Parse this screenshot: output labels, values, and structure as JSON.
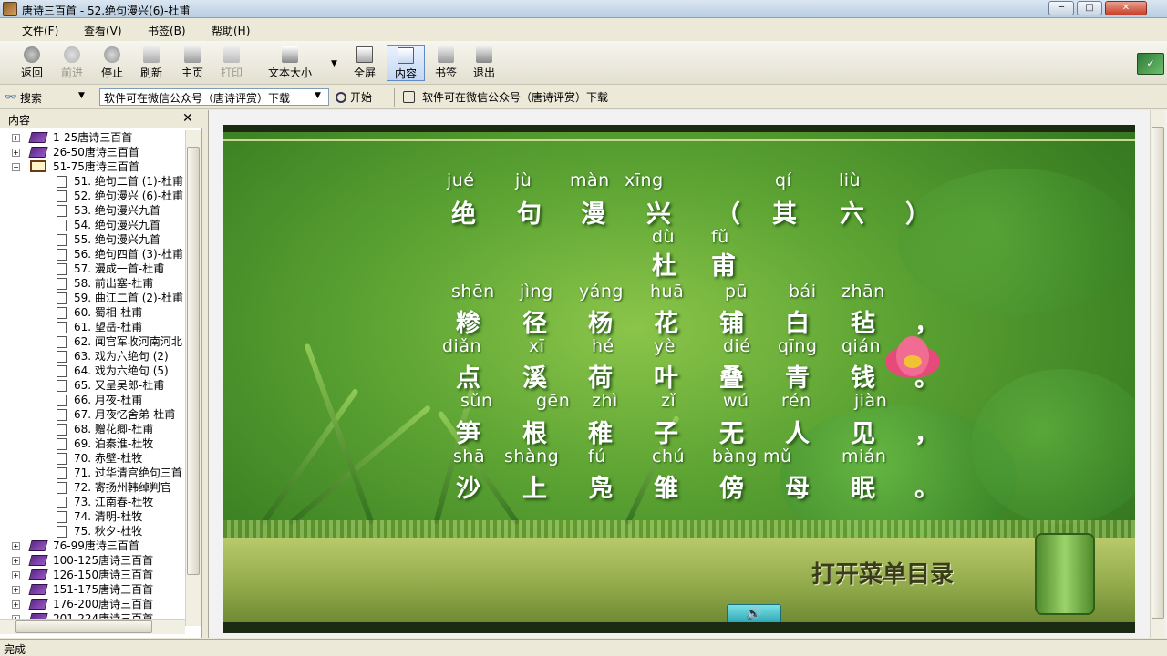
{
  "window": {
    "title": "唐诗三百首 - 52.绝句漫兴(6)-杜甫",
    "min": "─",
    "max": "□",
    "close": "✕"
  },
  "menu": [
    "文件(F)",
    "查看(V)",
    "书签(B)",
    "帮助(H)"
  ],
  "toolbar": {
    "back": "返回",
    "forward": "前进",
    "stop": "停止",
    "refresh": "刷新",
    "home": "主页",
    "print": "打印",
    "textsize": "文本大小",
    "fullscreen": "全屏",
    "contents": "内容",
    "bookmarks": "书签",
    "exit": "退出"
  },
  "search": {
    "label": "搜索",
    "value": "软件可在微信公众号（唐诗评赏）下载",
    "go": "开始",
    "ad": "软件可在微信公众号（唐诗评赏）下载"
  },
  "leftpane": {
    "title": "内容",
    "books_top": [
      {
        "label": "1-25唐诗三百首",
        "expander": "+"
      },
      {
        "label": "26-50唐诗三百首",
        "expander": "+"
      },
      {
        "label": "51-75唐诗三百首",
        "expander": "−"
      }
    ],
    "pages": [
      "51. 绝句二首 (1)-杜甫",
      "52. 绝句漫兴 (6)-杜甫",
      "53. 绝句漫兴九首",
      "54. 绝句漫兴九首",
      "55. 绝句漫兴九首",
      "56. 绝句四首 (3)-杜甫",
      "57. 漫成一首-杜甫",
      "58. 前出塞-杜甫",
      "59. 曲江二首 (2)-杜甫",
      "60. 蜀相-杜甫",
      "61. 望岳-杜甫",
      "62. 闻官军收河南河北",
      "63. 戏为六绝句 (2)",
      "64. 戏为六绝句 (5)",
      "65. 又呈吴郎-杜甫",
      "66. 月夜-杜甫",
      "67. 月夜忆舍弟-杜甫",
      "68. 赠花卿-杜甫",
      "69. 泊秦淮-杜牧",
      "70. 赤壁-杜牧",
      "71. 过华清宫绝句三首",
      "72. 寄扬州韩绰判官",
      "73. 江南春-杜牧",
      "74. 清明-杜牧",
      "75. 秋夕-杜牧"
    ],
    "books_bottom": [
      {
        "label": "76-99唐诗三百首",
        "expander": "+"
      },
      {
        "label": "100-125唐诗三百首",
        "expander": "+"
      },
      {
        "label": "126-150唐诗三百首",
        "expander": "+"
      },
      {
        "label": "151-175唐诗三百首",
        "expander": "+"
      },
      {
        "label": "176-200唐诗三百首",
        "expander": "+"
      },
      {
        "label": "201-224唐诗三百首",
        "expander": "+"
      }
    ]
  },
  "poem": {
    "title_pinyin": [
      "jué",
      "jù",
      "màn",
      "xīng",
      "qí",
      "liù"
    ],
    "title_chars": [
      "绝",
      "句",
      "漫",
      "兴",
      "（",
      "其",
      "六",
      "）"
    ],
    "author_pinyin": [
      "dù",
      "fǔ"
    ],
    "author_chars": [
      "杜",
      "甫"
    ],
    "lines": [
      {
        "pinyin": [
          "shēn",
          "jìng",
          "yáng",
          "huā",
          "pū",
          "bái",
          "zhān"
        ],
        "chars": [
          "糁",
          "径",
          "杨",
          "花",
          "铺",
          "白",
          "毡",
          "，"
        ]
      },
      {
        "pinyin": [
          "diǎn",
          "xī",
          "hé",
          "yè",
          "dié",
          "qīng",
          "qián"
        ],
        "chars": [
          "点",
          "溪",
          "荷",
          "叶",
          "叠",
          "青",
          "钱",
          "。"
        ]
      },
      {
        "pinyin": [
          "sǔn",
          "gēn",
          "zhì",
          "zǐ",
          "wú",
          "rén",
          "jiàn"
        ],
        "chars": [
          "笋",
          "根",
          "稚",
          "子",
          "无",
          "人",
          "见",
          "，"
        ]
      },
      {
        "pinyin": [
          "shā",
          "shàng",
          "fú",
          "chú",
          "bàng",
          "mǔ",
          "mián"
        ],
        "chars": [
          "沙",
          "上",
          "凫",
          "雏",
          "傍",
          "母",
          "眠",
          "。"
        ]
      }
    ],
    "menu_button": "打开菜单目录",
    "speaker_icon": "speaker-icon"
  },
  "status": {
    "text": "完成"
  }
}
